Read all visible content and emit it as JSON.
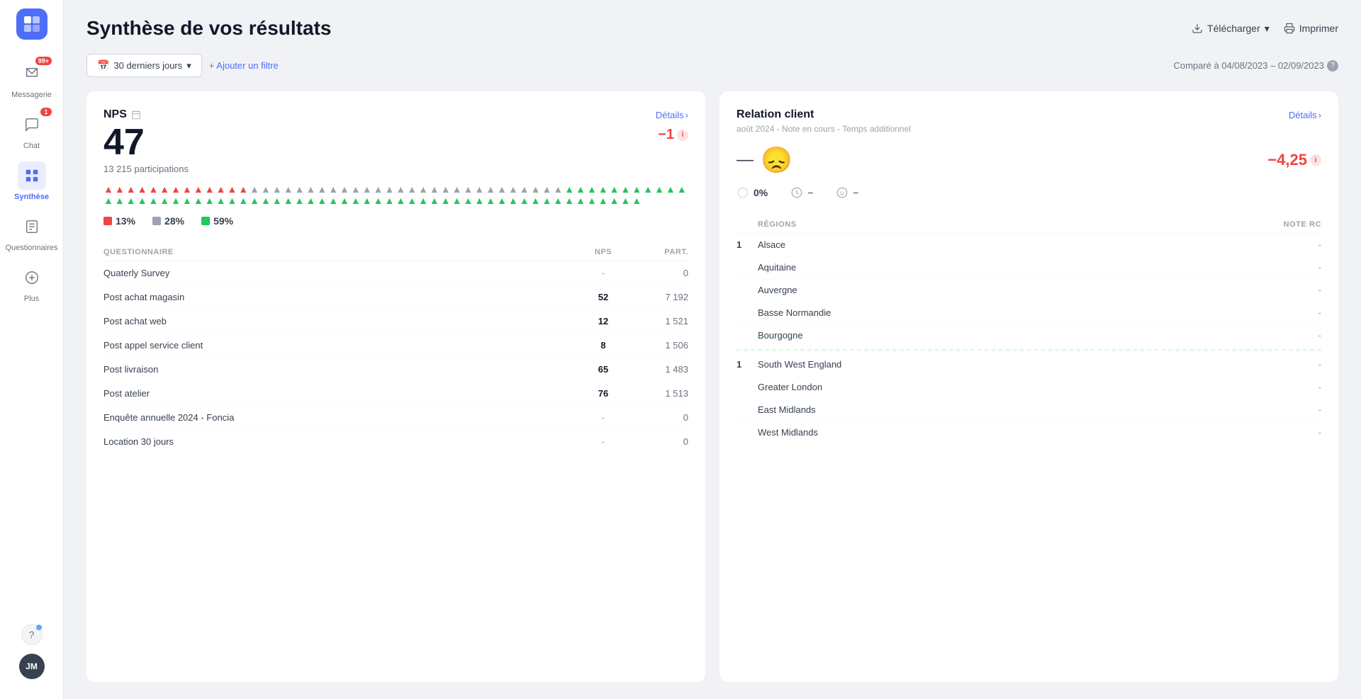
{
  "sidebar": {
    "logo_alt": "App Logo",
    "items": [
      {
        "id": "messagerie",
        "label": "Messagerie",
        "badge": "99+",
        "active": false
      },
      {
        "id": "chat",
        "label": "Chat",
        "badge": "1",
        "active": false
      },
      {
        "id": "synthese",
        "label": "Synthèse",
        "badge": null,
        "active": true
      },
      {
        "id": "questionnaires",
        "label": "Questionnaires",
        "badge": null,
        "active": false
      },
      {
        "id": "plus",
        "label": "Plus",
        "badge": null,
        "active": false
      }
    ],
    "help_label": "?",
    "avatar_label": "JM"
  },
  "header": {
    "title": "Synthèse de vos résultats",
    "telecharger": "Télécharger",
    "imprimer": "Imprimer"
  },
  "filters": {
    "date_range": "30 derniers jours",
    "add_filter": "+ Ajouter un filtre",
    "compare_label": "Comparé à 04/08/2023 – 02/09/2023"
  },
  "nps_card": {
    "title": "NPS",
    "details": "Détails",
    "score": "47",
    "change": "−1",
    "participations": "13 215 participations",
    "detractors_pct": "13%",
    "passives_pct": "28%",
    "promoters_pct": "59%",
    "table": {
      "col_questionnaire": "QUESTIONNAIRE",
      "col_nps": "NPS",
      "col_part": "Part.",
      "rows": [
        {
          "name": "Quaterly Survey",
          "nps": "-",
          "part": "0"
        },
        {
          "name": "Post achat magasin",
          "nps": "52",
          "part": "7 192"
        },
        {
          "name": "Post achat web",
          "nps": "12",
          "part": "1 521"
        },
        {
          "name": "Post appel service client",
          "nps": "8",
          "part": "1 506"
        },
        {
          "name": "Post livraison",
          "nps": "65",
          "part": "1 483"
        },
        {
          "name": "Post atelier",
          "nps": "76",
          "part": "1 513"
        },
        {
          "name": "Enquête annuelle 2024 - Foncia",
          "nps": "-",
          "part": "0"
        },
        {
          "name": "Location 30 jours",
          "nps": "-",
          "part": "0"
        }
      ]
    }
  },
  "rc_card": {
    "title": "Relation client",
    "details": "Détails",
    "subtitle": "août 2024 - Note en cours - Temps additionnel",
    "change": "−4,25",
    "metric1_val": "0%",
    "metric1_label": "",
    "metric2_label": "−",
    "metric3_label": "−",
    "regions": {
      "col_num": "",
      "col_region": "RÉGIONS",
      "col_note": "Note RC",
      "rows_fr": [
        {
          "num": "1",
          "name": "Alsace",
          "note": "-"
        },
        {
          "num": "",
          "name": "Aquitaine",
          "note": "-"
        },
        {
          "num": "",
          "name": "Auvergne",
          "note": "-"
        },
        {
          "num": "",
          "name": "Basse Normandie",
          "note": "-"
        },
        {
          "num": "",
          "name": "Bourgogne",
          "note": "-"
        }
      ],
      "rows_uk": [
        {
          "num": "1",
          "name": "South West England",
          "note": "-"
        },
        {
          "num": "",
          "name": "Greater London",
          "note": "-"
        },
        {
          "num": "",
          "name": "East Midlands",
          "note": "-"
        },
        {
          "num": "",
          "name": "West Midlands",
          "note": "-"
        }
      ]
    }
  }
}
